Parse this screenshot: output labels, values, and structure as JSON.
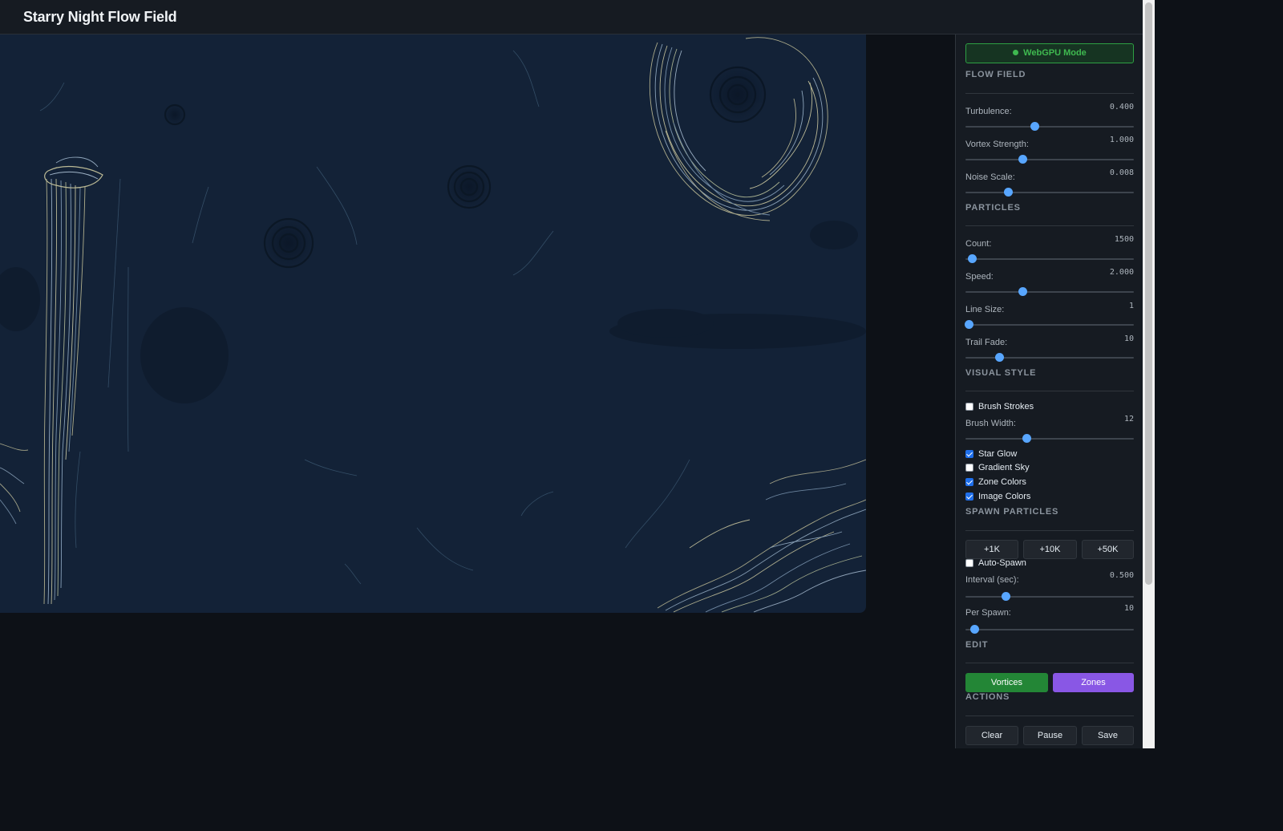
{
  "app": {
    "title": "Starry Night Flow Field"
  },
  "mode": {
    "label": "WebGPU Mode",
    "status_color": "#3fb950"
  },
  "flow_field": {
    "title": "FLOW FIELD",
    "turbulence": {
      "label": "Turbulence:",
      "value": "0.400",
      "level": 0.41
    },
    "vortex": {
      "label": "Vortex Strength:",
      "value": "1.000",
      "level": 0.34
    },
    "noise": {
      "label": "Noise Scale:",
      "value": "0.008",
      "level": 0.25
    }
  },
  "particles": {
    "title": "PARTICLES",
    "count": {
      "label": "Count:",
      "value": "1500",
      "level": 0.04
    },
    "speed": {
      "label": "Speed:",
      "value": "2.000",
      "level": 0.34
    },
    "line_size": {
      "label": "Line Size:",
      "value": "1",
      "level": 0.02
    },
    "trail_fade": {
      "label": "Trail Fade:",
      "value": "10",
      "level": 0.2
    }
  },
  "visual_style": {
    "title": "VISUAL STYLE",
    "brush_strokes": {
      "label": "Brush Strokes",
      "checked": false
    },
    "brush_width": {
      "label": "Brush Width:",
      "value": "12",
      "level": 0.36
    },
    "star_glow": {
      "label": "Star Glow",
      "checked": true
    },
    "gradient_sky": {
      "label": "Gradient Sky",
      "checked": false
    },
    "zone_colors": {
      "label": "Zone Colors",
      "checked": true
    },
    "image_colors": {
      "label": "Image Colors",
      "checked": true
    }
  },
  "spawn": {
    "title": "SPAWN PARTICLES",
    "buttons": [
      "+1K",
      "+10K",
      "+50K"
    ],
    "auto_spawn": {
      "label": "Auto-Spawn",
      "checked": false
    },
    "interval": {
      "label": "Interval (sec):",
      "value": "0.500",
      "level": 0.24
    },
    "per_spawn": {
      "label": "Per Spawn:",
      "value": "10",
      "level": 0.05
    }
  },
  "edit": {
    "title": "EDIT",
    "vortices": "Vortices",
    "zones": "Zones"
  },
  "actions": {
    "title": "ACTIONS",
    "clear": "Clear",
    "pause": "Pause",
    "save": "Save"
  },
  "colors": {
    "canvas_bg": "#132237",
    "accent": "#58a6ff",
    "green": "#238636",
    "purple": "#8957e5"
  }
}
